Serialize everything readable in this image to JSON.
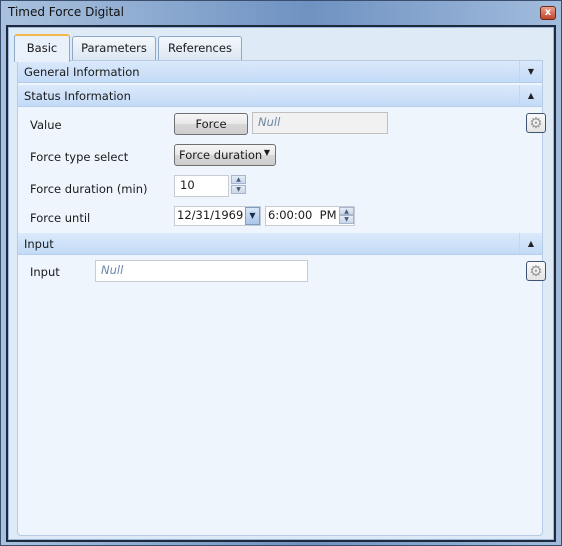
{
  "window": {
    "title": "Timed Force Digital",
    "close_label": "x"
  },
  "tabs": [
    {
      "label": "Basic",
      "active": true
    },
    {
      "label": "Parameters",
      "active": false
    },
    {
      "label": "References",
      "active": false
    }
  ],
  "sections": {
    "general": {
      "title": "General Information",
      "toggle_icon": "▼",
      "expanded": false
    },
    "status": {
      "title": "Status Information",
      "toggle_icon": "▲",
      "expanded": true
    },
    "input": {
      "title": "Input",
      "toggle_icon": "▲",
      "expanded": true
    }
  },
  "status": {
    "value_label": "Value",
    "force_button": "Force",
    "value_field": {
      "value": "",
      "placeholder": "Null"
    },
    "force_type_label": "Force type select",
    "force_type_selected": "Force duration",
    "duration_label": "Force duration (min)",
    "duration_value": "10",
    "until_label": "Force until",
    "until_date": "12/31/1969",
    "until_time": "6:00:00  PM"
  },
  "input": {
    "label": "Input",
    "field": {
      "value": "",
      "placeholder": "Null"
    }
  },
  "icons": {
    "gear": "⚙",
    "up": "▲",
    "down": "▼"
  }
}
